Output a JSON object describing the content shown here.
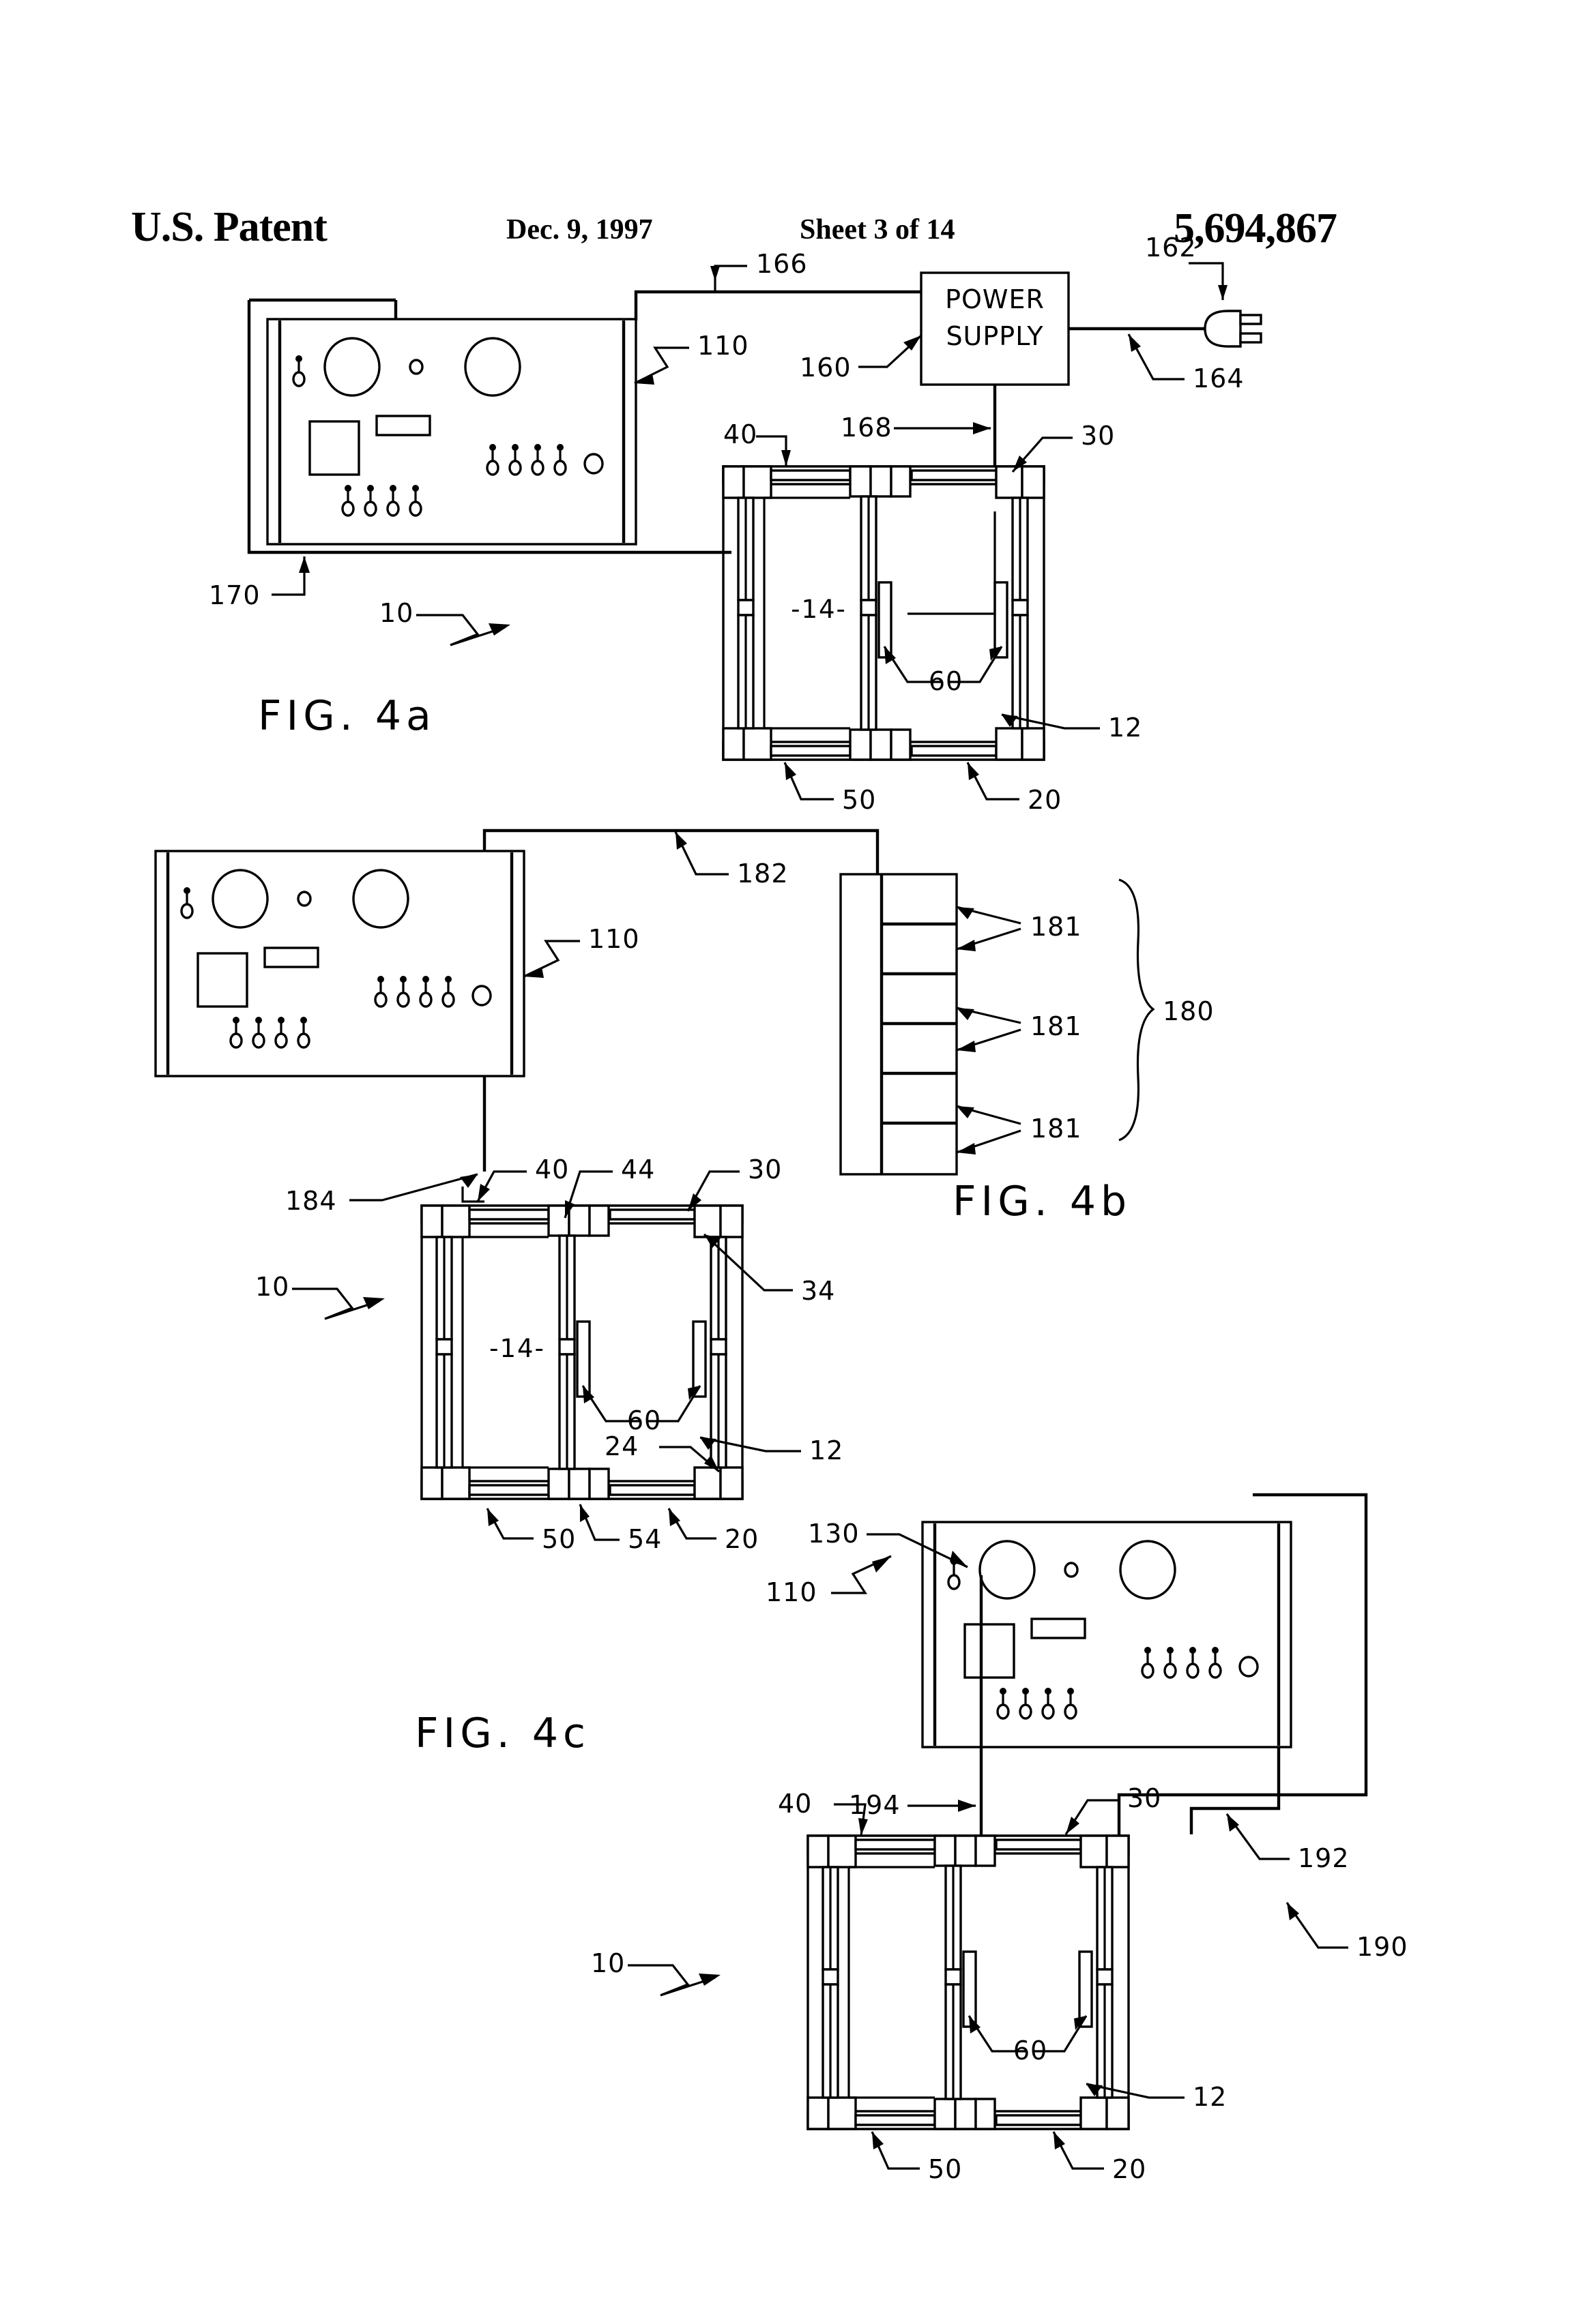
{
  "header": {
    "office": "U.S. Patent",
    "date": "Dec. 9, 1997",
    "sheet": "Sheet 3 of 14",
    "patent_number": "5,694,867"
  },
  "figures": [
    {
      "caption": "FIG.  4a",
      "refs": [
        "166",
        "162",
        "110",
        "160",
        "164",
        "168",
        "40",
        "30",
        "170",
        "10",
        "60",
        "12",
        "50",
        "20"
      ],
      "frame_inner_label": "-14-",
      "power_supply_line1": "POWER",
      "power_supply_line2": "SUPPLY"
    },
    {
      "caption": "FIG.  4b",
      "refs": [
        "182",
        "181",
        "181",
        "181",
        "180",
        "110",
        "184",
        "40",
        "44",
        "30",
        "34",
        "10",
        "60",
        "24",
        "12",
        "50",
        "54",
        "20"
      ],
      "frame_inner_label": "-14-"
    },
    {
      "caption": "FIG.  4c",
      "refs": [
        "130",
        "110",
        "40",
        "194",
        "30",
        "192",
        "190",
        "10",
        "60",
        "12",
        "50",
        "20"
      ],
      "frame_inner_label": ""
    }
  ],
  "labels": {
    "n10": "10",
    "n12": "12",
    "n14": "-14-",
    "n20": "20",
    "n24": "24",
    "n30": "30",
    "n34": "34",
    "n40": "40",
    "n44": "44",
    "n50": "50",
    "n54": "54",
    "n60": "60",
    "n110": "110",
    "n130": "130",
    "n160": "160",
    "n162": "162",
    "n164": "164",
    "n166": "166",
    "n168": "168",
    "n170": "170",
    "n180": "180",
    "n181": "181",
    "n182": "182",
    "n184": "184",
    "n190": "190",
    "n192": "192",
    "n194": "194",
    "power_supply_1": "POWER",
    "power_supply_2": "SUPPLY",
    "fig4a": "FIG.  4a",
    "fig4b": "FIG.  4b",
    "fig4c": "FIG.  4c"
  },
  "colors": {
    "ink": "#000000",
    "paper": "#ffffff"
  }
}
